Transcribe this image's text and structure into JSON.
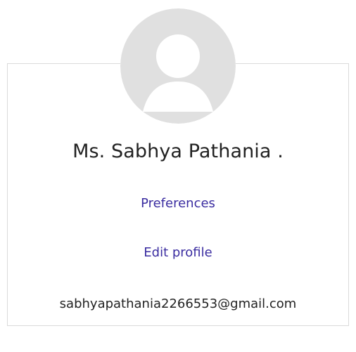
{
  "profile": {
    "avatar_icon": "default-user-avatar-icon",
    "avatar_color": "#e0e0e0",
    "name": "Ms. Sabhya Pathania .",
    "email": "sabhyapathania2266553@gmail.com"
  },
  "links": {
    "preferences": "Preferences",
    "edit_profile": "Edit profile"
  },
  "colors": {
    "link": "#3a2ca0",
    "text": "#222222",
    "card_border": "#dadada"
  }
}
